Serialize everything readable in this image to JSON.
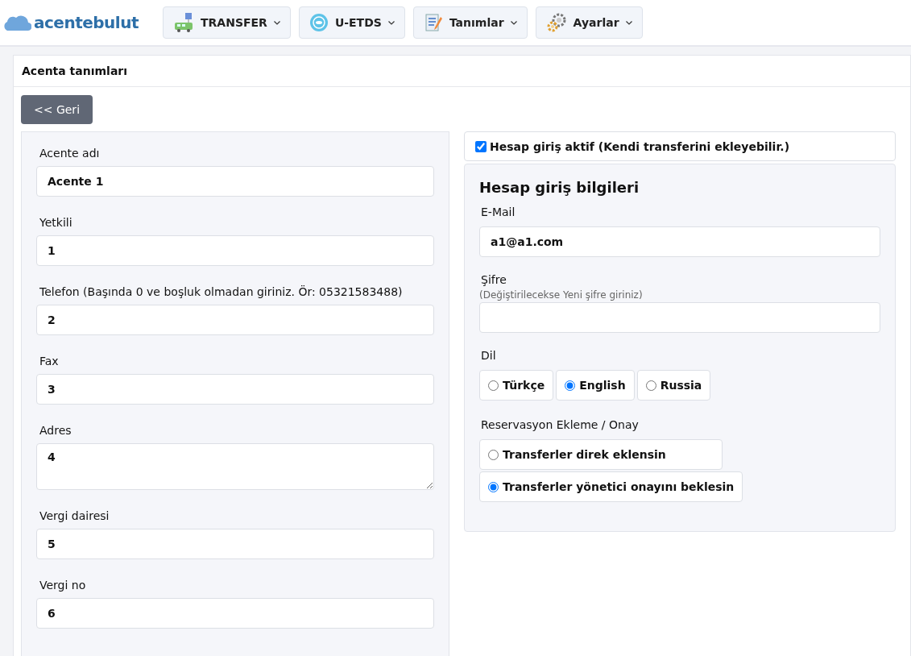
{
  "header": {
    "logo": "acentebulut",
    "menus": [
      {
        "label": "TRANSFER"
      },
      {
        "label": "U-ETDS"
      },
      {
        "label": "Tanımlar"
      },
      {
        "label": "Ayarlar"
      }
    ]
  },
  "card": {
    "title": "Acenta tanımları",
    "back_button": "<< Geri",
    "fields": [
      {
        "kind": "input",
        "label": "Acente adı",
        "value": "Acente 1"
      },
      {
        "kind": "input",
        "label": "Yetkili",
        "value": "1"
      },
      {
        "kind": "input",
        "label": "Telefon (Başında 0 ve boşluk olmadan giriniz. Ör: 05321583488)",
        "value": "2"
      },
      {
        "kind": "input",
        "label": "Fax",
        "value": "3"
      },
      {
        "kind": "textarea",
        "label": "Adres",
        "value": "4"
      },
      {
        "kind": "input",
        "label": "Vergi dairesi",
        "value": "5"
      },
      {
        "kind": "input",
        "label": "Vergi no",
        "value": "6"
      }
    ],
    "login_active": {
      "label": "Hesap giriş aktif (Kendi transferini ekleyebilir.)",
      "checked": true
    },
    "login": {
      "title": "Hesap giriş bilgileri",
      "email_label": "E-Mail",
      "email": "a1@a1.com",
      "password_label": "Şifre",
      "password_hint": "(Değiştirilecekse Yeni şifre giriniz)",
      "language_label": "Dil",
      "languages": [
        {
          "label": "Türkçe",
          "selected": false
        },
        {
          "label": "English",
          "selected": true
        },
        {
          "label": "Russia",
          "selected": false
        }
      ],
      "reservation_label": "Reservasyon Ekleme / Onay",
      "reservation_options": [
        {
          "label": "Transferler direk eklensin",
          "selected": false
        },
        {
          "label": "Transferler yönetici onayını beklesin",
          "selected": true
        }
      ]
    }
  }
}
